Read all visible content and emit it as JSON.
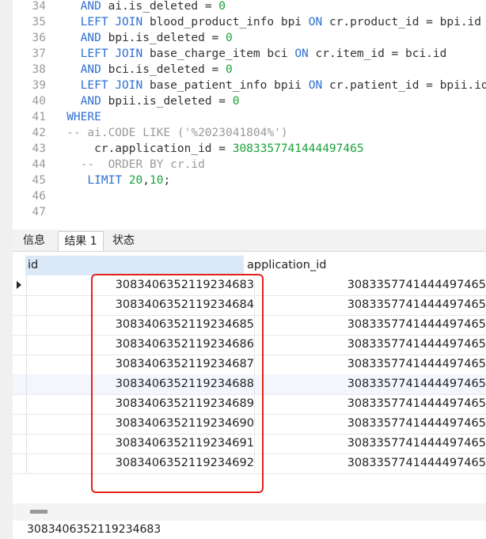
{
  "editor": {
    "lines": [
      {
        "n": "34",
        "parts": [
          {
            "t": "  ",
            "c": ""
          },
          {
            "t": "AND",
            "c": "kw"
          },
          {
            "t": " ai.is_deleted = ",
            "c": "idt"
          },
          {
            "t": "0",
            "c": "num"
          }
        ]
      },
      {
        "n": "35",
        "parts": [
          {
            "t": "  ",
            "c": ""
          },
          {
            "t": "LEFT JOIN",
            "c": "kw"
          },
          {
            "t": " blood_product_info bpi ",
            "c": "idt"
          },
          {
            "t": "ON",
            "c": "kw"
          },
          {
            "t": " cr.product_id = bpi.id",
            "c": "idt"
          }
        ]
      },
      {
        "n": "36",
        "parts": [
          {
            "t": "  ",
            "c": ""
          },
          {
            "t": "AND",
            "c": "kw"
          },
          {
            "t": " bpi.is_deleted = ",
            "c": "idt"
          },
          {
            "t": "0",
            "c": "num"
          }
        ]
      },
      {
        "n": "37",
        "parts": [
          {
            "t": "  ",
            "c": ""
          },
          {
            "t": "LEFT JOIN",
            "c": "kw"
          },
          {
            "t": " base_charge_item bci ",
            "c": "idt"
          },
          {
            "t": "ON",
            "c": "kw"
          },
          {
            "t": " cr.item_id = bci.id",
            "c": "idt"
          }
        ]
      },
      {
        "n": "38",
        "parts": [
          {
            "t": "  ",
            "c": ""
          },
          {
            "t": "AND",
            "c": "kw"
          },
          {
            "t": " bci.is_deleted = ",
            "c": "idt"
          },
          {
            "t": "0",
            "c": "num"
          }
        ]
      },
      {
        "n": "39",
        "parts": [
          {
            "t": "  ",
            "c": ""
          },
          {
            "t": "LEFT JOIN",
            "c": "kw"
          },
          {
            "t": " base_patient_info bpii ",
            "c": "idt"
          },
          {
            "t": "ON",
            "c": "kw"
          },
          {
            "t": " cr.patient_id = bpii.id",
            "c": "idt"
          }
        ]
      },
      {
        "n": "40",
        "parts": [
          {
            "t": "  ",
            "c": ""
          },
          {
            "t": "AND",
            "c": "kw"
          },
          {
            "t": " bpii.is_deleted = ",
            "c": "idt"
          },
          {
            "t": "0",
            "c": "num"
          }
        ]
      },
      {
        "n": "41",
        "parts": [
          {
            "t": "WHERE",
            "c": "kw"
          }
        ]
      },
      {
        "n": "42",
        "parts": [
          {
            "t": "-- ai.CODE LIKE ('%2023041804%')",
            "c": "cm"
          }
        ]
      },
      {
        "n": "43",
        "parts": [
          {
            "t": "    cr.application_id = ",
            "c": "idt"
          },
          {
            "t": "3083357741444497465",
            "c": "num"
          }
        ]
      },
      {
        "n": "44",
        "parts": [
          {
            "t": "  --  ORDER BY cr.id",
            "c": "cm"
          }
        ]
      },
      {
        "n": "45",
        "parts": [
          {
            "t": "   ",
            "c": ""
          },
          {
            "t": "LIMIT",
            "c": "kw"
          },
          {
            "t": " ",
            "c": ""
          },
          {
            "t": "20",
            "c": "num"
          },
          {
            "t": ",",
            "c": "idt"
          },
          {
            "t": "10",
            "c": "num"
          },
          {
            "t": ";",
            "c": "idt"
          }
        ]
      },
      {
        "n": "46",
        "parts": []
      },
      {
        "n": "47",
        "parts": []
      }
    ]
  },
  "tabs": [
    "信息",
    "结果 1",
    "状态"
  ],
  "grid": {
    "columns": [
      "id",
      "application_id"
    ],
    "rows": [
      [
        "308340635211923468​3",
        "3083357741444497465"
      ]
    ]
  },
  "status_text": "308340635211923468​3"
}
